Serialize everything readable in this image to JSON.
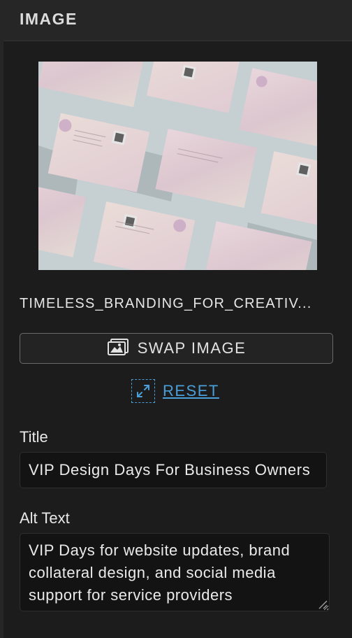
{
  "panel": {
    "title": "IMAGE"
  },
  "image": {
    "filename": "TIMELESS_BRANDING_FOR_CREATIV...",
    "swap_label": "SWAP IMAGE",
    "reset_label": "RESET"
  },
  "fields": {
    "title_label": "Title",
    "title_value": "VIP Design Days For Business Owners",
    "alt_label": "Alt Text",
    "alt_value": "VIP Days for website updates, brand collateral design, and social media support for service providers"
  },
  "colors": {
    "background": "#1c1c1c",
    "header": "#262626",
    "accent_link": "#4a9fd8",
    "input_bg": "#131313"
  },
  "icons": {
    "swap": "image-icon",
    "reset": "expand-arrows-icon",
    "resize": "resize-handle-icon"
  }
}
